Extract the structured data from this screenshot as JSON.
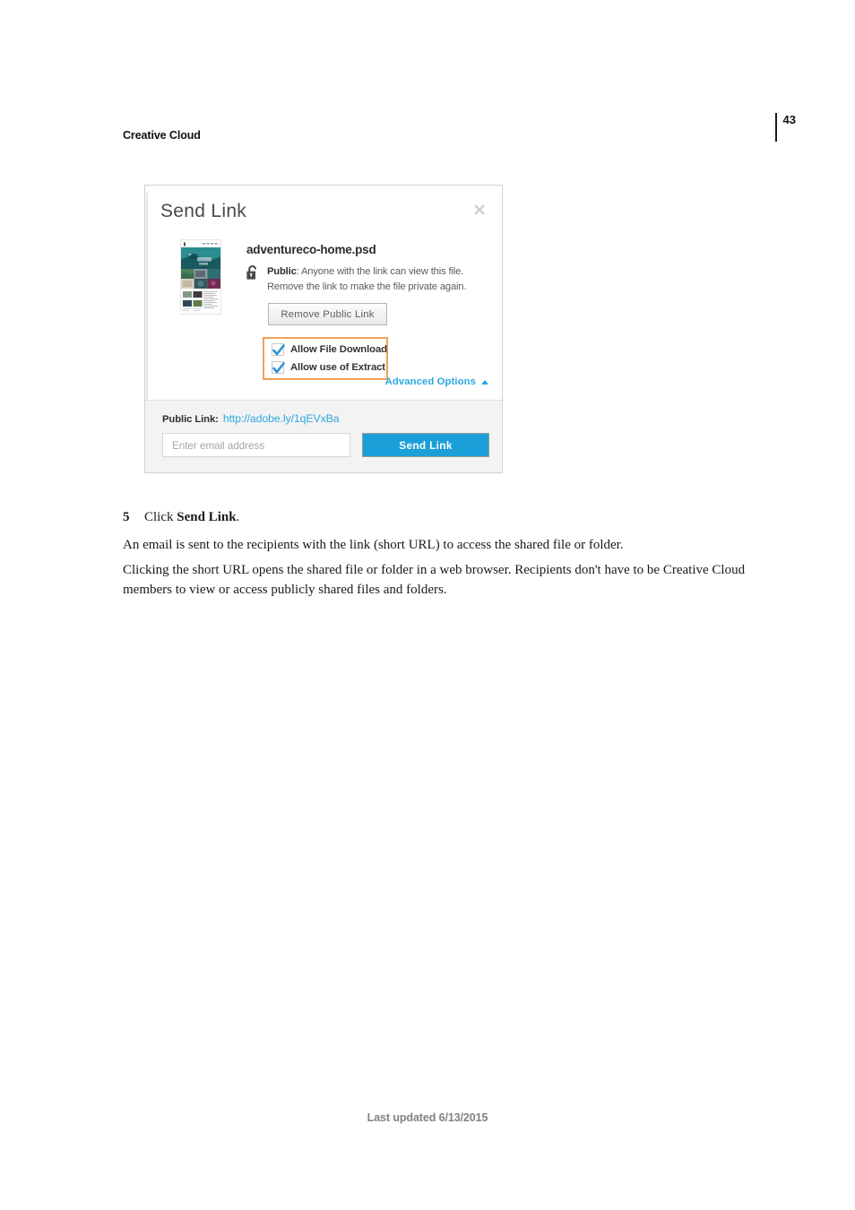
{
  "page": {
    "running_head": "Creative Cloud",
    "page_number": "43",
    "footer": "Last updated 6/13/2015"
  },
  "dialog": {
    "title": "Send Link",
    "close_icon": "close-icon",
    "file_name": "adventureco-home.psd",
    "lock_icon": "unlocked-padlock-icon",
    "permission_label": "Public",
    "permission_text": ": Anyone with the link can view this file. Remove the link to make the file private again.",
    "remove_button": "Remove Public Link",
    "checkboxes": [
      {
        "label": "Allow File Download",
        "checked": true
      },
      {
        "label": "Allow use of Extract",
        "checked": true
      }
    ],
    "advanced_options": "Advanced Options",
    "advanced_caret_icon": "chevron-up-icon",
    "public_link_label": "Public Link:",
    "public_link_url": "http://adobe.ly/1qEVxBa",
    "email_placeholder": "Enter email address",
    "email_value": "",
    "send_button": "Send Link",
    "highlight_color": "#f0a15a",
    "accent_color": "#1b9fd8",
    "link_color": "#2ea7e0",
    "thumbnail_icon": "website-mockup-thumbnail"
  },
  "body": {
    "step_number": "5",
    "step_prefix": "Click ",
    "step_bold": "Send Link",
    "step_suffix": ".",
    "paragraph_1": "An email is sent to the recipients with the link (short URL) to access the shared file or folder.",
    "paragraph_2": "Clicking the short URL opens the shared file or folder in a web browser. Recipients don't have to be Creative Cloud members to view or access publicly shared files and folders."
  }
}
